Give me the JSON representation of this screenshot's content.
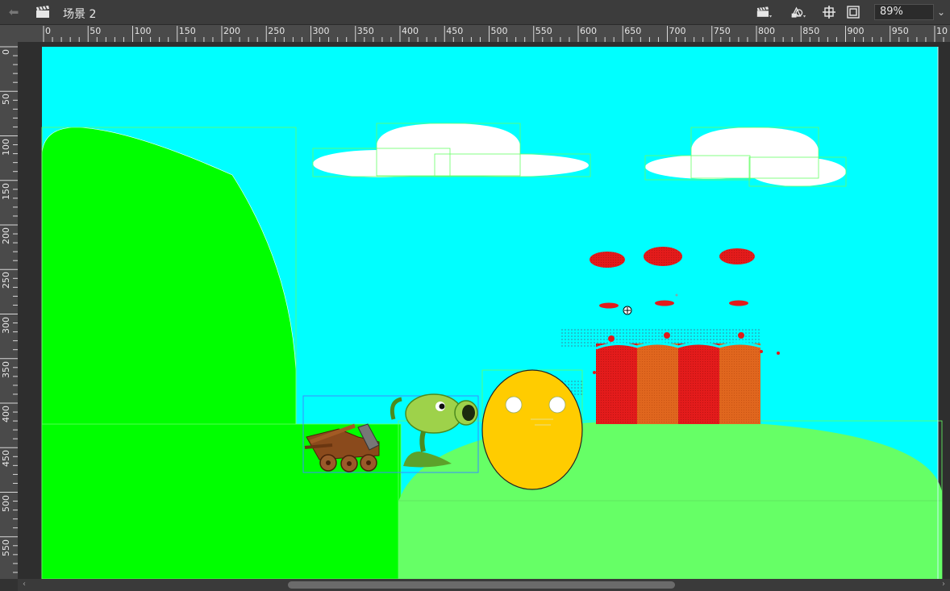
{
  "toolbar": {
    "scene_name": "场景 2",
    "zoom_value": "89%",
    "icons": [
      "back-arrow-icon",
      "clapperboard-icon",
      "scene-menu-icon",
      "symbol-menu-icon",
      "snap-crosshair-icon",
      "clip-stage-icon",
      "zoom-dropdown-icon"
    ]
  },
  "ruler": {
    "top_labels": [
      "0",
      "50",
      "100",
      "150",
      "200",
      "250",
      "300",
      "350",
      "400",
      "450",
      "500",
      "550",
      "600",
      "650",
      "700",
      "750",
      "800",
      "850",
      "900",
      "950",
      "10"
    ],
    "left_labels": [
      "0",
      "50",
      "100",
      "150",
      "200",
      "250",
      "300",
      "350",
      "400",
      "450",
      "500",
      "550"
    ]
  },
  "stage": {
    "sky_color": "#00ffff",
    "hill_left_color": "#00ff00",
    "ground_left_color": "#00ff00",
    "hill_right_color": "#66ff66",
    "cloud_color": "#ffffff",
    "face_color": "#ffcc00",
    "building_red": "#e31b1b",
    "building_orange": "#e0661e",
    "selection_color": "#7fff7f",
    "selection_blue": "#3a8dff"
  }
}
